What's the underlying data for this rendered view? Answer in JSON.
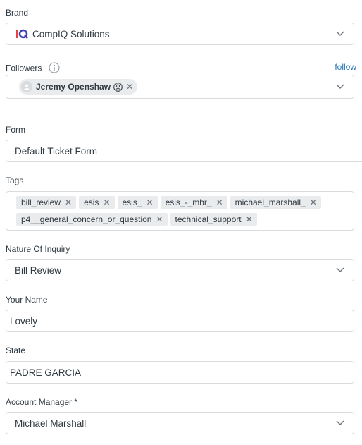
{
  "brand": {
    "label": "Brand",
    "value": "CompIQ Solutions",
    "logo_text": "iQ"
  },
  "followers": {
    "label": "Followers",
    "follow_link": "follow",
    "items": [
      {
        "name": "Jeremy Openshaw"
      }
    ]
  },
  "form": {
    "label": "Form",
    "value": "Default Ticket Form"
  },
  "tags": {
    "label": "Tags",
    "rows": [
      [
        "bill_review",
        "esis",
        "esis_",
        "esis_-_mbr_",
        "michael_marshall_"
      ],
      [
        "p4__general_concern_or_question",
        "technical_support"
      ]
    ]
  },
  "nature_of_inquiry": {
    "label": "Nature Of Inquiry",
    "value": "Bill Review"
  },
  "your_name": {
    "label": "Your Name",
    "value": "Lovely"
  },
  "state": {
    "label": "State",
    "value": "PADRE GARCIA"
  },
  "account_manager": {
    "label": "Account Manager *",
    "value": "Michael Marshall"
  },
  "colors": {
    "link": "#1f73b7",
    "border": "#d8dcde",
    "tag_bg": "#e9ebed",
    "text": "#2f3941"
  }
}
